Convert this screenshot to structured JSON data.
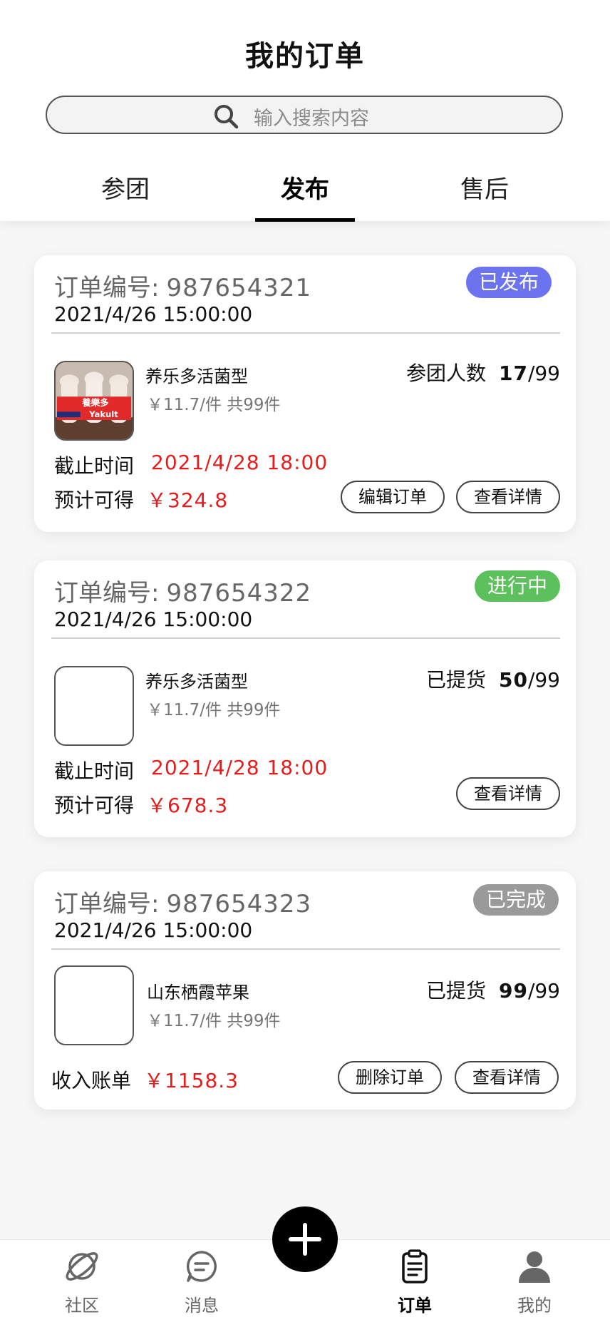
{
  "header": {
    "title": "我的订单",
    "search_placeholder": "输入搜索内容",
    "tabs": [
      {
        "label": "参团"
      },
      {
        "label": "发布"
      },
      {
        "label": "售后"
      }
    ]
  },
  "orders": [
    {
      "order_label": "订单编号:",
      "order_no": "987654321",
      "time": "2021/4/26 15:00:00",
      "status": "已发布",
      "status_color": "#6b73ef",
      "product_name": "养乐多活菌型",
      "product_price": "￥11.7/件 共99件",
      "count_label": "参团人数",
      "count_value": "17",
      "count_total": "/99",
      "deadline_label": "截止时间",
      "deadline_value": "2021/4/28 18:00",
      "income_label": "预计可得",
      "income_value": "￥324.8",
      "buttons": [
        "编辑订单",
        "查看详情"
      ]
    },
    {
      "order_label": "订单编号:",
      "order_no": "987654322",
      "time": "2021/4/26 15:00:00",
      "status": "进行中",
      "status_color": "#5cc15c",
      "product_name": "养乐多活菌型",
      "product_price": "￥11.7/件 共99件",
      "count_label": "已提货",
      "count_value": "50",
      "count_total": "/99",
      "deadline_label": "截止时间",
      "deadline_value": "2021/4/28 18:00",
      "income_label": "预计可得",
      "income_value": "￥678.3",
      "buttons": [
        "查看详情"
      ]
    },
    {
      "order_label": "订单编号:",
      "order_no": "987654323",
      "time": "2021/4/26 15:00:00",
      "status": "已完成",
      "status_color": "#9a9a9a",
      "product_name": "山东栖霞苹果",
      "product_price": "￥11.7/件 共99件",
      "count_label": "已提货",
      "count_value": "99",
      "count_total": "/99",
      "income_label": "收入账单",
      "income_value": "￥1158.3",
      "buttons": [
        "删除订单",
        "查看详情"
      ]
    }
  ],
  "product_image": {
    "brand_text": "養樂多",
    "brand_latin": "Yakult"
  },
  "bottom_nav": [
    {
      "label": "社区",
      "icon": "planet-icon"
    },
    {
      "label": "消息",
      "icon": "message-icon"
    },
    {
      "label": "订单",
      "icon": "clipboard-icon"
    },
    {
      "label": "我的",
      "icon": "user-icon"
    }
  ],
  "fab_icon": "plus-icon"
}
